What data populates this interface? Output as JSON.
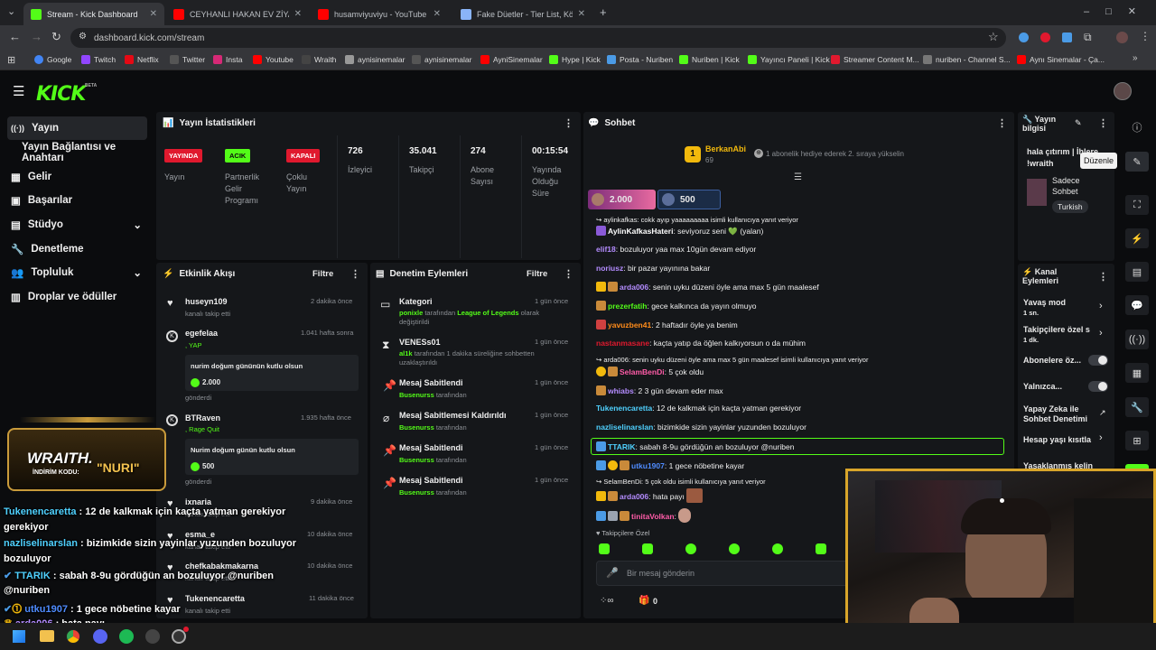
{
  "browser": {
    "tabs": [
      {
        "label": "Stream - Kick Dashboard",
        "favicon": "kick-icon"
      },
      {
        "label": "CEYHANLI HAKAN EV ZİYARETİ",
        "favicon": "youtube-icon"
      },
      {
        "label": "husamviyuviyu - YouTube",
        "favicon": "youtube-icon"
      },
      {
        "label": "Fake Düetler - Tier List, Kör Sıra",
        "favicon": "tierlist-icon"
      }
    ],
    "url": "dashboard.kick.com/stream",
    "bookmarks": [
      "Google",
      "Twitch",
      "Netflix",
      "Twitter",
      "Insta",
      "Youtube",
      "Wraith",
      "aynisinemalar",
      "aynisinemalar",
      "AyniSinemalar",
      "Hype | Kick",
      "Posta - Nuriben",
      "Nuriben | Kick",
      "Yayıncı Paneli | Kick",
      "Streamer Content M...",
      "nuriben - Channel S...",
      "Aynı Sinemalar - Ça..."
    ]
  },
  "brand": {
    "logo": "KICK",
    "beta": "BETA"
  },
  "sidebar": {
    "items": [
      {
        "label": "Yayın",
        "icon": "broadcast-icon"
      },
      {
        "label": "Yayın Bağlantısı ve Anahtarı"
      },
      {
        "label": "Gelir",
        "icon": "revenue-icon"
      },
      {
        "label": "Başarılar",
        "icon": "achievements-icon"
      },
      {
        "label": "Stüdyo",
        "icon": "studio-icon"
      },
      {
        "label": "Denetleme",
        "icon": "moderation-icon"
      },
      {
        "label": "Topluluk",
        "icon": "community-icon"
      },
      {
        "label": "Droplar ve ödüller",
        "icon": "drops-icon"
      }
    ]
  },
  "stats": {
    "title": "Yayın İstatistikleri",
    "items": [
      {
        "badge": "YAYINDA",
        "label": "Yayın",
        "color": "#e0192e"
      },
      {
        "badge": "ACIK",
        "label": "Partnerlik Gelir Programı",
        "color": "#53fc18"
      },
      {
        "badge": "KAPALI",
        "label": "Çoklu Yayın",
        "color": "#e0192e"
      },
      {
        "value": "726",
        "label": "İzleyici"
      },
      {
        "value": "35.041",
        "label": "Takipçi"
      },
      {
        "value": "274",
        "label": "Abone Sayısı"
      },
      {
        "value": "00:15:54",
        "label": "Yayında Olduğu Süre"
      }
    ]
  },
  "activity": {
    "title": "Etkinlik Akışı",
    "filter": "Filtre",
    "events": [
      {
        "user": "huseyn109",
        "time": "2 dakika önce",
        "desc": "kanalı takip etti"
      },
      {
        "user": "egefelaa",
        "time": "1.041 hafta sonra",
        "desc": ", YAP",
        "message": "nurim doğum gününün kutlu olsun",
        "amount": "2.000",
        "footer": "gönderdi"
      },
      {
        "user": "BTRaven",
        "time": "1.935 hafta önce",
        "desc": ", Rage Quit",
        "message": "Nurim doğum günün kutlu olsun",
        "amount": "500",
        "footer": "gönderdi"
      },
      {
        "user": "ixnaria",
        "time": "9 dakika önce",
        "desc": "kanalı takip etti"
      },
      {
        "user": "esma_e",
        "time": "10 dakika önce",
        "desc": "kanalı takip etti"
      },
      {
        "user": "chefkabakmakarna",
        "time": "10 dakika önce",
        "desc": "kanalı takip etti"
      },
      {
        "user": "Tukenencaretta",
        "time": "11 dakika önce",
        "desc": "kanalı takip etti"
      }
    ]
  },
  "moderation": {
    "title": "Denetim Eylemleri",
    "filter": "Filtre",
    "actions": [
      {
        "title": "Kategori",
        "time": "1 gün önce",
        "actor": "ponixle",
        "text": " tarafından ",
        "target": "League of Legends",
        "tail": " olarak değiştirildi"
      },
      {
        "title": "VENESs01",
        "time": "1 gün önce",
        "actor": "al1k",
        "text": " tarafından 1 dakika süreliğine sohbetten uzaklaştırıldı"
      },
      {
        "title": "Mesaj Sabitlendi",
        "time": "1 gün önce",
        "actor": "Busenurss",
        "text": " tarafından"
      },
      {
        "title": "Mesaj Sabitlemesi Kaldırıldı",
        "time": "1 gün önce",
        "actor": "Busenurss",
        "text": " tarafından"
      },
      {
        "title": "Mesaj Sabitlendi",
        "time": "1 gün önce",
        "actor": "Busenurss",
        "text": " tarafından"
      },
      {
        "title": "Mesaj Sabitlendi",
        "time": "1 gün önce",
        "actor": "Busenurss",
        "text": " tarafından"
      }
    ]
  },
  "chat": {
    "title": "Sohbet",
    "gift": {
      "user": "BerkanAbi",
      "count": "69",
      "rank": "1",
      "text": "1 abonelik hediye ederek 2. sıraya yükselin"
    },
    "boosts": [
      "2.000",
      "500"
    ],
    "messages": [
      {
        "user": "",
        "text": "aylinkafkas: cokk ayıp yaaaaaaaaa isimli kullanıcıya yanıt veriyor",
        "reply": true
      },
      {
        "user": "AylinKafkasHateri",
        "text": "seviyoruz seni 💚 (yalan)",
        "color": "#ffffff"
      },
      {
        "user": "elif18",
        "text": "bozuluyor yaa max 10gün devam ediyor",
        "color": "#b48cff"
      },
      {
        "user": "noriusz",
        "text": "bir pazar yayınına bakar",
        "color": "#b48cff"
      },
      {
        "user": "arda006",
        "text": "senin uyku düzeni öyle ama max 5 gün maalesef",
        "color": "#b48cff"
      },
      {
        "user": "prezerfatih",
        "text": "gece kalkınca da yayın olmuyo",
        "color": "#53fc18"
      },
      {
        "user": "yavuzben41",
        "text": "2 haftadır öyle ya benim",
        "color": "#ff8c1a"
      },
      {
        "user": "nastanmasane",
        "text": "kaçta yatıp da öğlen kalkıyorsun o da mühim",
        "color": "#e0192e"
      },
      {
        "user": "",
        "text": "arda006: senin uyku düzeni öyle ama max 5 gün maalesef isimli kullanıcıya yanıt veriyor",
        "reply": true
      },
      {
        "user": "SelamBenDi",
        "text": "5 çok oldu",
        "color": "#ff5ca8"
      },
      {
        "user": "whiabs",
        "text": "2 3 gün devam eder max",
        "color": "#b48cff"
      },
      {
        "user": "Tukenencaretta",
        "text": "12 de kalkmak için kaçta yatman gerekiyor",
        "color": "#4fd1ff"
      },
      {
        "user": "nazliselinarslan",
        "text": "bizimkide sizin yayinlar yuzunden bozuluyor",
        "color": "#4fd1ff"
      },
      {
        "user": "TTARIK",
        "text": "sabah 8-9u gördüğün an bozuluyor @nuriben",
        "color": "#4fd1ff"
      },
      {
        "user": "utku1907",
        "text": "1 gece nöbetine kayar",
        "color": "#4f8cff"
      },
      {
        "user": "",
        "text": "SelamBenDi: 5 çok oldu isimli kullanıcıya yanıt veriyor",
        "reply": true
      },
      {
        "user": "arda006",
        "text": "hata payı",
        "color": "#b48cff"
      },
      {
        "user": "tinitaVolkan",
        "text": "",
        "color": "#ff5ca8"
      }
    ],
    "followers_only": "Takipçilere Özel",
    "input_placeholder": "Bir mesaj gönderin",
    "counter": "0"
  },
  "stream_info": {
    "title": "Yayın bilgisi",
    "stream_title": "hala çıtırım | İhlere !wraith",
    "tooltip": "Düzenle",
    "mode": "Sadece Sohbet",
    "language": "Turkish"
  },
  "channel_actions": {
    "title": "Kanal Eylemleri",
    "items": [
      {
        "label": "Yavaş mod",
        "sub": "1 sn."
      },
      {
        "label": "Takipçilere özel s",
        "sub": "1 dk."
      },
      {
        "label": "Abonelere öz..."
      },
      {
        "label": "Yalnızca..."
      },
      {
        "label": "Yapay Zeka ile Sohbet Denetimi"
      },
      {
        "label": "Hesap yaşı kısıtla"
      },
      {
        "label": "Yasaklanmış kelin"
      }
    ]
  },
  "overlay": {
    "brand": "WRAITH.",
    "code_label": "İNDİRİM KODU:",
    "code": "\"NURI\"",
    "chat": [
      {
        "user": "Tukenencaretta",
        "text": " : 12 de kalkmak için kaçta yatman gerekiyor",
        "color": "#4fd1ff"
      },
      {
        "user": "nazliselinarslan",
        "text": " : bizimkide sizin yayinlar yuzunden bozuluyor",
        "color": "#4fd1ff"
      },
      {
        "user": "TTARIK",
        "text": " : sabah 8-9u gördüğün an bozuluyor @nuriben",
        "color": "#4fd1ff"
      },
      {
        "user": "utku1907",
        "text": " : 1 gece nöbetine kayar",
        "color": "#4f8cff"
      },
      {
        "user": "arda006",
        "text": " : hata payı",
        "color": "#b48cff"
      }
    ]
  }
}
